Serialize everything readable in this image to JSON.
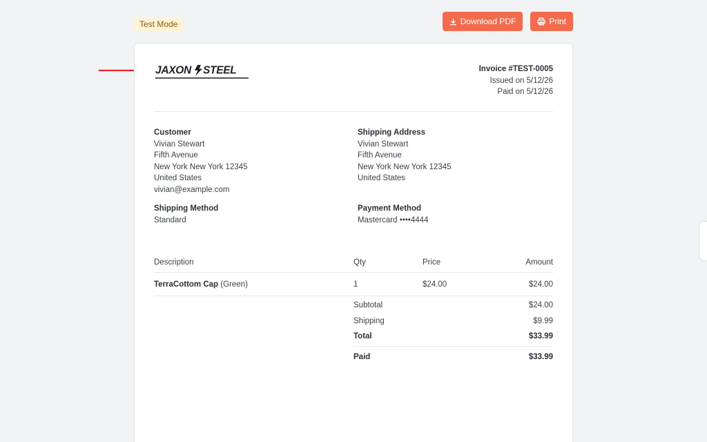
{
  "header": {
    "badge": "Test Mode",
    "download_label": "Download PDF",
    "print_label": "Print"
  },
  "invoice": {
    "number": "Invoice #TEST-0005",
    "issued": "Issued on 5/12/26",
    "paid": "Paid on 5/12/26",
    "logo_text": "JAXON STEEL"
  },
  "customer": {
    "heading": "Customer",
    "lines": [
      "Vivian Stewart",
      "Fifth Avenue",
      "New York New York 12345",
      "United States",
      "vivian@example.com"
    ]
  },
  "shipping_address": {
    "heading": "Shipping Address",
    "lines": [
      "Vivian Stewart",
      "Fifth Avenue",
      "New York New York 12345",
      "United States"
    ]
  },
  "shipping_method": {
    "heading": "Shipping Method",
    "value": "Standard"
  },
  "payment_method": {
    "heading": "Payment Method",
    "value": "Mastercard ••••4444"
  },
  "table": {
    "headers": {
      "description": "Description",
      "qty": "Qty",
      "price": "Price",
      "amount": "Amount"
    },
    "items": [
      {
        "name": "TerraCottom Cap",
        "variant": " (Green)",
        "qty": "1",
        "price": "$24.00",
        "amount": "$24.00"
      }
    ]
  },
  "totals": {
    "subtotal_label": "Subtotal",
    "subtotal": "$24.00",
    "shipping_label": "Shipping",
    "shipping": "$9.99",
    "total_label": "Total",
    "total": "$33.99",
    "paid_label": "Paid",
    "paid": "$33.99"
  },
  "colors": {
    "accent": "#f26b4d",
    "badge_bg": "#fdf3d7",
    "badge_text": "#8a5a14",
    "arrow": "#e8262a"
  },
  "icons": {
    "download": "download-icon",
    "print": "printer-icon",
    "arrow": "arrow-right-icon"
  }
}
